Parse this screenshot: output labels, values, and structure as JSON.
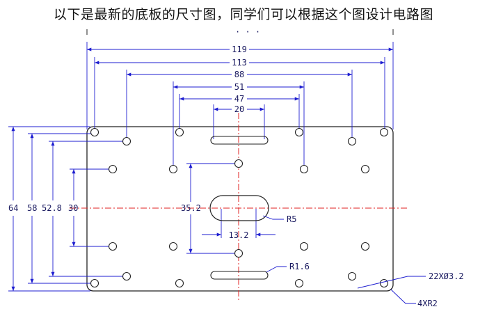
{
  "caption": "以下是最新的底板的尺寸图，同学们可以根据这个图设计电路图",
  "colors": {
    "outline": "#222222",
    "dimension": "#1d1dd0",
    "centerline": "#e02020",
    "text": "#1a1a60"
  },
  "dimensions": {
    "horizontal": [
      "119",
      "113",
      "88",
      "51",
      "47",
      "20"
    ],
    "vertical": [
      "64",
      "58",
      "52.8",
      "30"
    ],
    "slot_spacing": "35.2",
    "slot_width": "13.2"
  },
  "notes": {
    "slot_radius": "R5",
    "small_slot_radius": "R1.6",
    "holes": "22XØ3.2",
    "corners": "4XR2"
  },
  "top_marks": "· · ·"
}
